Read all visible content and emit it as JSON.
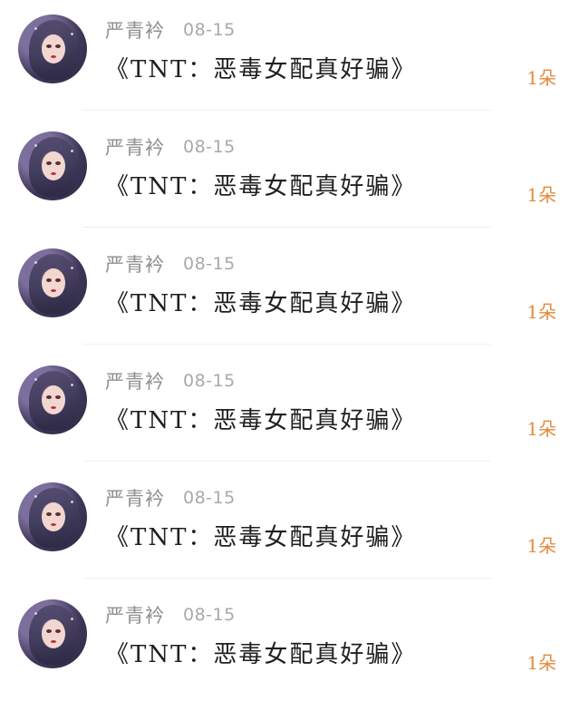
{
  "items": [
    {
      "user": "严青衿",
      "date": "08-15",
      "title": "《TNT：恶毒女配真好骗》",
      "count": "1朵"
    },
    {
      "user": "严青衿",
      "date": "08-15",
      "title": "《TNT：恶毒女配真好骗》",
      "count": "1朵"
    },
    {
      "user": "严青衿",
      "date": "08-15",
      "title": "《TNT：恶毒女配真好骗》",
      "count": "1朵"
    },
    {
      "user": "严青衿",
      "date": "08-15",
      "title": "《TNT：恶毒女配真好骗》",
      "count": "1朵"
    },
    {
      "user": "严青衿",
      "date": "08-15",
      "title": "《TNT：恶毒女配真好骗》",
      "count": "1朵"
    },
    {
      "user": "严青衿",
      "date": "08-15",
      "title": "《TNT：恶毒女配真好骗》",
      "count": "1朵"
    }
  ],
  "colors": {
    "count_accent": "#e28a3b",
    "name_gray": "#8f8f8f",
    "date_gray": "#a9a9a9"
  },
  "icons": {
    "avatar": "anime-girl-avatar"
  }
}
